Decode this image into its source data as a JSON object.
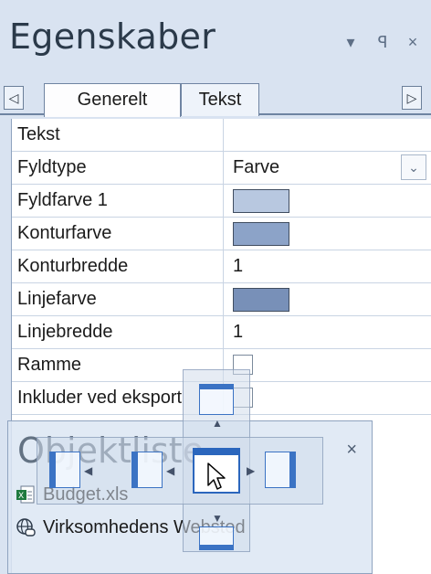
{
  "properties_panel": {
    "title": "Egenskaber",
    "header_buttons": {
      "dropdown": "▾",
      "pin": "ꟼ",
      "close": "×"
    },
    "tabs": [
      {
        "label": "Generelt",
        "active": true
      },
      {
        "label": "Tekst",
        "active": false
      }
    ],
    "scroll_left": "◁",
    "scroll_right": "▷",
    "rows": [
      {
        "name": "Tekst",
        "value": ""
      },
      {
        "name": "Fyldtype",
        "value": "Farve",
        "dropdown": "⌄"
      },
      {
        "name": "Fyldfarve 1",
        "swatch": "#b8c8e0"
      },
      {
        "name": "Konturfarve",
        "swatch": "#8ca3c8"
      },
      {
        "name": "Konturbredde",
        "value": "1"
      },
      {
        "name": "Linjefarve",
        "swatch": "#7890b8"
      },
      {
        "name": "Linjebredde",
        "value": "1"
      },
      {
        "name": "Ramme",
        "value": ""
      },
      {
        "name": "Inkluder ved eksport",
        "value": ""
      }
    ]
  },
  "object_list": {
    "title": "Objektliste",
    "close": "×",
    "items": [
      {
        "label": "Budget.xls",
        "icon": "excel-file-icon"
      },
      {
        "label": "Virksomhedens Websted",
        "icon": "web-link-icon"
      }
    ]
  },
  "colors": {
    "panel_bg": "#d9e3f1",
    "accent": "#2b66bd",
    "grid_line": "#c9d4e3"
  }
}
